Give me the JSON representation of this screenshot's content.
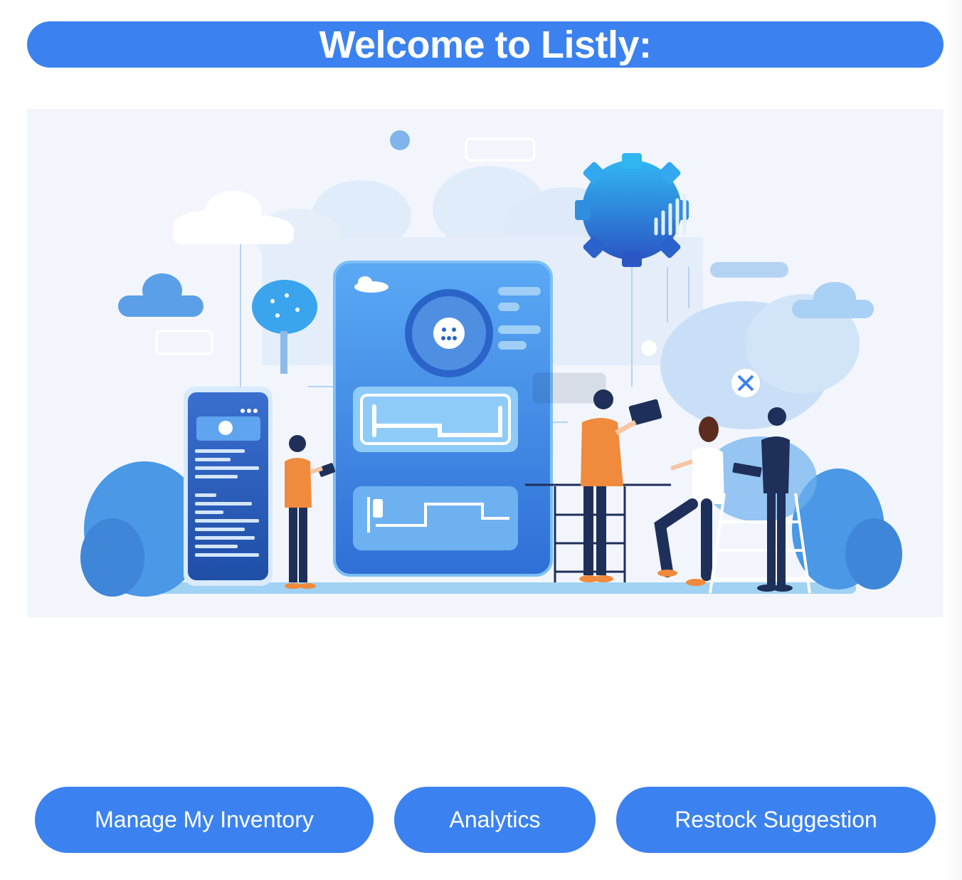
{
  "header": {
    "title": "Welcome to Listly:"
  },
  "hero": {
    "image_name": "inventory-management-illustration",
    "colors": {
      "background": "#f2f6fc",
      "primary": "#3b82f0",
      "accent": "#f08a3c",
      "dark": "#1e2f5a"
    }
  },
  "actions": {
    "manage_inventory": "Manage My Inventory",
    "analytics": "Analytics",
    "restock_suggestion": "Restock Suggestion"
  },
  "theme": {
    "accent": "#3b82f0",
    "button_text": "#ffffff",
    "page_background": "#ffffff"
  }
}
